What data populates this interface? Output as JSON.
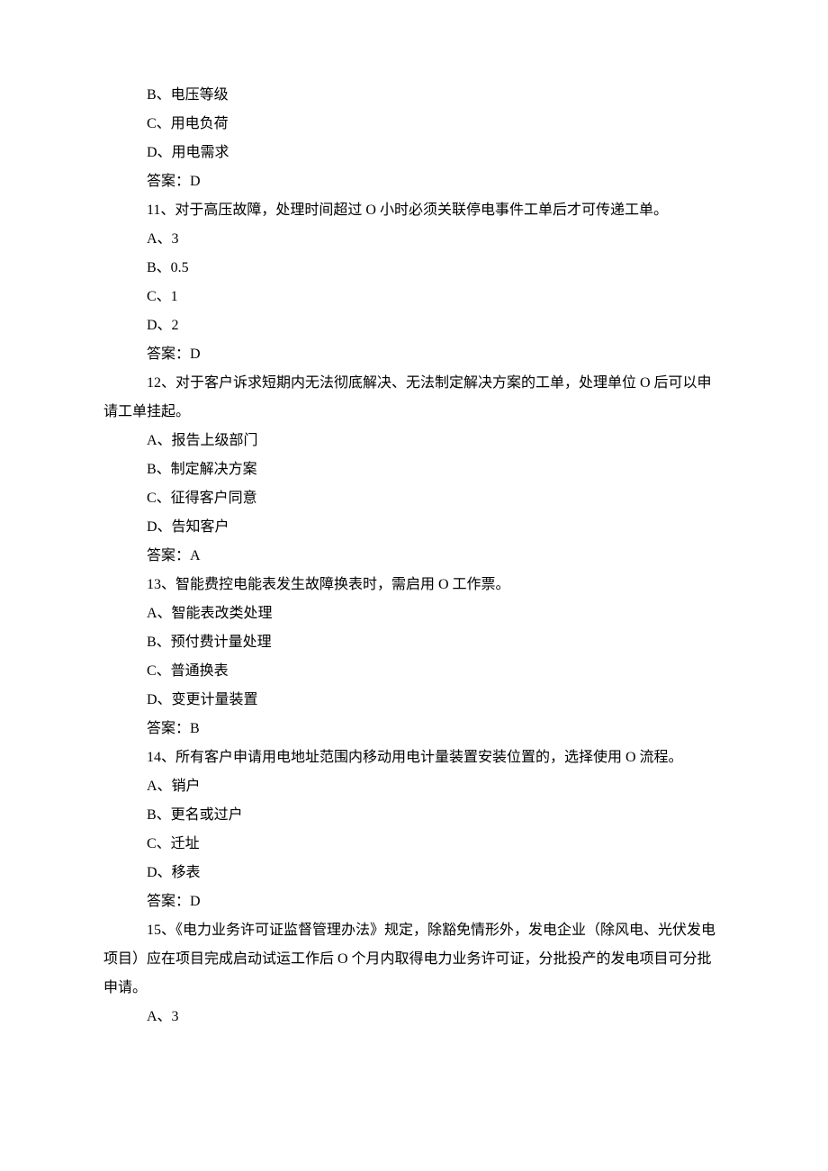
{
  "lines": [
    {
      "indent": 1,
      "text": "B、电压等级"
    },
    {
      "indent": 1,
      "text": "C、用电负荷"
    },
    {
      "indent": 1,
      "text": "D、用电需求"
    },
    {
      "indent": 1,
      "text": "答案：D"
    },
    {
      "indent": -1,
      "text": "11、对于高压故障，处理时间超过 O 小时必须关联停电事件工单后才可传递工单。"
    },
    {
      "indent": 1,
      "text": "A、3"
    },
    {
      "indent": 1,
      "text": "B、0.5"
    },
    {
      "indent": 1,
      "text": "C、1"
    },
    {
      "indent": 1,
      "text": "D、2"
    },
    {
      "indent": 1,
      "text": "答案：D"
    },
    {
      "indent": -1,
      "text": "12、对于客户诉求短期内无法彻底解决、无法制定解决方案的工单，处理单位 O 后可以申请工单挂起。"
    },
    {
      "indent": 1,
      "text": "A、报告上级部门"
    },
    {
      "indent": 1,
      "text": "B、制定解决方案"
    },
    {
      "indent": 1,
      "text": "C、征得客户同意"
    },
    {
      "indent": 1,
      "text": "D、告知客户"
    },
    {
      "indent": 1,
      "text": "答案：A"
    },
    {
      "indent": 1,
      "text": "13、智能费控电能表发生故障换表时，需启用 O 工作票。"
    },
    {
      "indent": 1,
      "text": "A、智能表改类处理"
    },
    {
      "indent": 1,
      "text": "B、预付费计量处理"
    },
    {
      "indent": 1,
      "text": "C、普通换表"
    },
    {
      "indent": 1,
      "text": "D、变更计量装置"
    },
    {
      "indent": 1,
      "text": "答案：B"
    },
    {
      "indent": -1,
      "text": "14、所有客户申请用电地址范围内移动用电计量装置安装位置的，选择使用 O 流程。"
    },
    {
      "indent": 1,
      "text": "A、销户"
    },
    {
      "indent": 1,
      "text": "B、更名或过户"
    },
    {
      "indent": 1,
      "text": "C、迁址"
    },
    {
      "indent": 1,
      "text": "D、移表"
    },
    {
      "indent": 1,
      "text": "答案：D"
    },
    {
      "indent": -1,
      "text": "15、《电力业务许可证监督管理办法》规定，除豁免情形外，发电企业（除风电、光伏发电项目）应在项目完成启动试运工作后 O 个月内取得电力业务许可证，分批投产的发电项目可分批申请。"
    },
    {
      "indent": 1,
      "text": "A、3"
    }
  ]
}
